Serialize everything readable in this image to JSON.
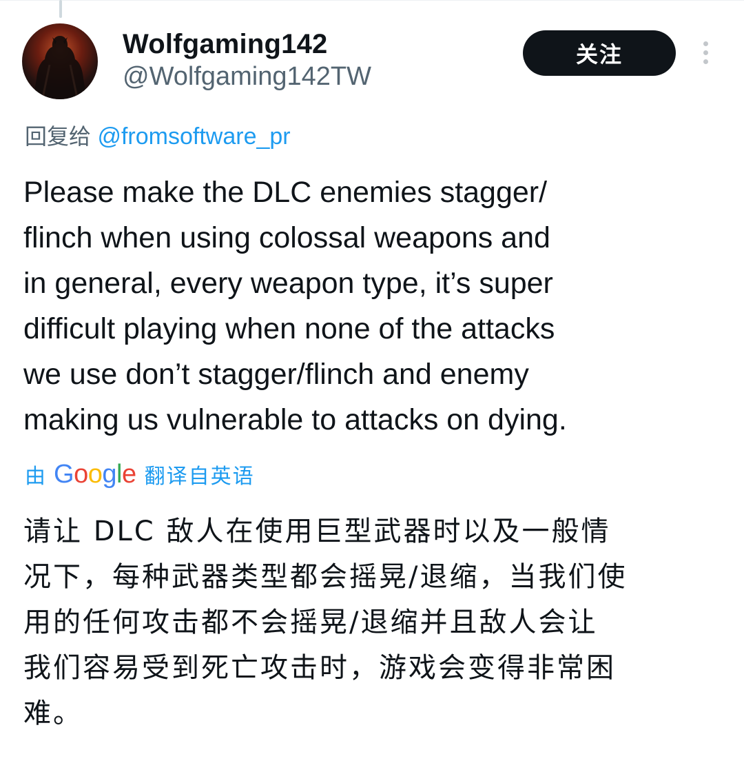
{
  "header": {
    "display_name": "Wolfgaming142",
    "handle": "@Wolfgaming142TW",
    "follow_label": "关注",
    "avatar_icon": "avatar-dark-knight",
    "more_icon": "vertical-ellipsis-icon"
  },
  "reply": {
    "prefix": "回复给",
    "mention": "@fromsoftware_pr"
  },
  "tweet": {
    "lines": [
      "Please make the DLC enemies stagger/",
      "flinch when using colossal weapons and",
      "in general, every weapon type, it’s super",
      "difficult playing when none of the attacks",
      "we use don’t stagger/flinch and enemy",
      "making us vulnerable to attacks on dying."
    ]
  },
  "translation": {
    "by": "由",
    "provider_letters": [
      "G",
      "o",
      "o",
      "g",
      "l",
      "e"
    ],
    "from_language": "翻译自英语",
    "lines": [
      "请让 DLC 敌人在使用巨型武器时以及一般情",
      "况下，每种武器类型都会摇晃/退缩，当我们使",
      "用的任何攻击都不会摇晃/退缩并且敌人会让",
      "我们容易受到死亡攻击时，游戏会变得非常困",
      "难。"
    ]
  },
  "colors": {
    "link": "#1d9bf0",
    "secondary_text": "#536471",
    "primary_text": "#0f1419",
    "follow_button_bg": "#0f1419"
  }
}
